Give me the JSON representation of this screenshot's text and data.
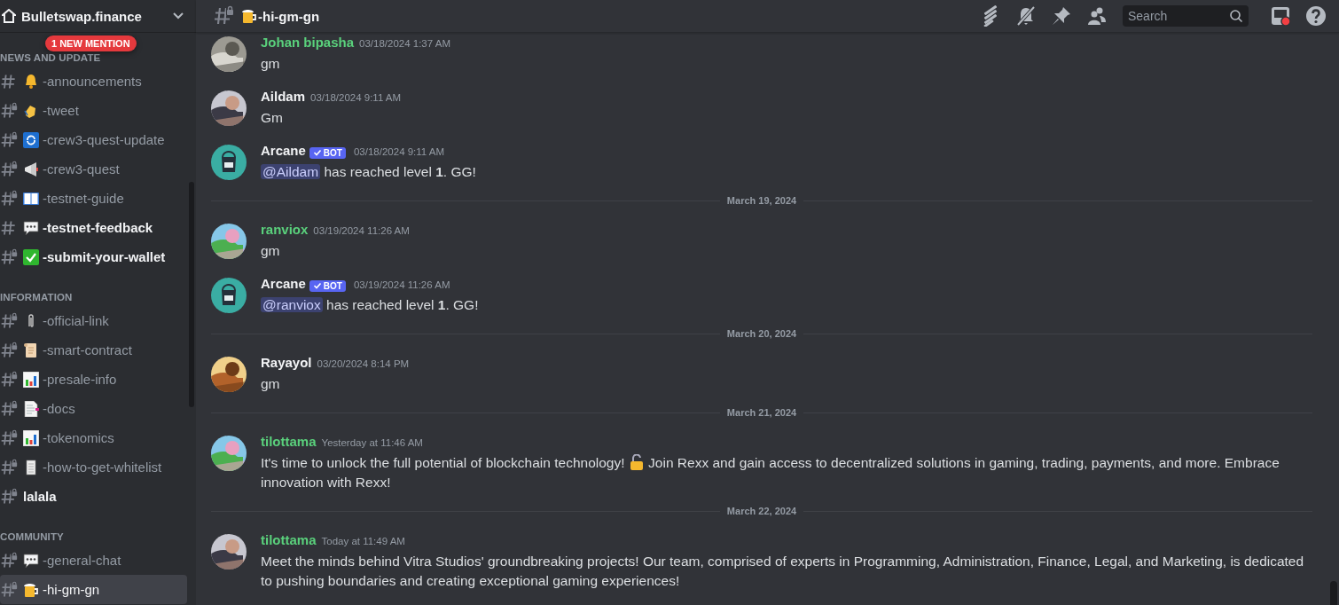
{
  "server": {
    "name": "Bulletswap.finance"
  },
  "mention_badge": "1 NEW MENTION",
  "sidebar": {
    "categories": [
      {
        "name": "NEWS AND UPDATE",
        "channels": [
          {
            "name": "-announcements",
            "kind": "bell",
            "locked": false,
            "unread": false,
            "selected": false
          },
          {
            "name": "-tweet",
            "kind": "clap",
            "locked": true,
            "unread": false,
            "selected": false
          },
          {
            "name": "-crew3-quest-update",
            "kind": "arrows",
            "locked": true,
            "unread": false,
            "selected": false
          },
          {
            "name": "-crew3-quest",
            "kind": "megaphone",
            "locked": true,
            "unread": false,
            "selected": false
          },
          {
            "name": "-testnet-guide",
            "kind": "book",
            "locked": true,
            "unread": false,
            "selected": false
          },
          {
            "name": "-testnet-feedback",
            "kind": "speech",
            "locked": false,
            "unread": true,
            "selected": false
          },
          {
            "name": "-submit-your-wallet",
            "kind": "check",
            "locked": true,
            "unread": true,
            "selected": false
          }
        ]
      },
      {
        "name": "INFORMATION",
        "channels": [
          {
            "name": "-official-link",
            "kind": "paperclip",
            "locked": true,
            "unread": false,
            "selected": false
          },
          {
            "name": "-smart-contract",
            "kind": "scroll",
            "locked": true,
            "unread": false,
            "selected": false
          },
          {
            "name": "-presale-info",
            "kind": "chart",
            "locked": true,
            "unread": false,
            "selected": false
          },
          {
            "name": "-docs",
            "kind": "page",
            "locked": true,
            "unread": false,
            "selected": false
          },
          {
            "name": "-tokenomics",
            "kind": "chart",
            "locked": true,
            "unread": false,
            "selected": false
          },
          {
            "name": "-how-to-get-whitelist",
            "kind": "receipt",
            "locked": true,
            "unread": false,
            "selected": false
          },
          {
            "name": "lalala",
            "kind": "plain",
            "locked": true,
            "unread": true,
            "selected": false
          }
        ]
      },
      {
        "name": "COMMUNITY",
        "channels": [
          {
            "name": "-general-chat",
            "kind": "speech",
            "locked": true,
            "unread": false,
            "selected": false
          },
          {
            "name": "-hi-gm-gn",
            "kind": "beer",
            "locked": true,
            "unread": false,
            "selected": true
          }
        ]
      }
    ]
  },
  "channel_header": {
    "name": "-hi-gm-gn",
    "kind": "beer",
    "locked": true,
    "search": {
      "placeholder": "Search"
    }
  },
  "messages": [
    {
      "kind": "message",
      "author": "Johan bipasha",
      "color": "#5ad17c",
      "time": "03/18/2024 1:37 AM",
      "text": "gm"
    },
    {
      "kind": "message",
      "author": "Aildam",
      "color": "#f2f3f5",
      "time": "03/18/2024 9:11 AM",
      "text": "Gm"
    },
    {
      "kind": "message",
      "author": "Arcane",
      "color": "#f2f3f5",
      "badge": "BOT",
      "time": "03/18/2024 9:11 AM",
      "avatar": {
        "kind": "bucket"
      },
      "mention": "@Aildam",
      "text": "has reached level **1**. GG!"
    },
    {
      "kind": "divider",
      "text": "March 19, 2024"
    },
    {
      "kind": "message",
      "author": "ranviox",
      "color": "#5ad17c",
      "time": "03/19/2024 11:26 AM",
      "text": "gm"
    },
    {
      "kind": "message",
      "author": "Arcane",
      "color": "#f2f3f5",
      "badge": "BOT",
      "time": "03/19/2024 11:26 AM",
      "avatar": {
        "kind": "bucket"
      },
      "mention": "@ranviox",
      "text": "has reached level **1**. GG!"
    },
    {
      "kind": "divider",
      "text": "March 20, 2024"
    },
    {
      "kind": "message",
      "author": "Rayayol",
      "color": "#f2f3f5",
      "time": "03/20/2024 8:14 PM",
      "text": "gm"
    },
    {
      "kind": "divider",
      "text": "March 21, 2024"
    },
    {
      "kind": "message",
      "author": "tilottama",
      "color": "#5ad17c",
      "time": "Yesterday at 11:46 AM",
      "text": "It's time to unlock the full potential of blockchain technology!",
      "emoji": {
        "kind": "lock"
      },
      "text_after": "Join Rexx and gain access to decentralized solutions in gaming, trading, payments, and more. Embrace innovation with Rexx!"
    },
    {
      "kind": "divider",
      "text": "March 22, 2024"
    },
    {
      "kind": "message",
      "author": "tilottama",
      "color": "#5ad17c",
      "time": "Today at 11:49 AM",
      "text": "Meet the minds behind Vitra Studios' groundbreaking projects! Our team, comprised of experts in Programming, Administration, Finance, Legal, and Marketing, is dedicated to pushing boundaries and creating exceptional gaming experiences!"
    }
  ]
}
